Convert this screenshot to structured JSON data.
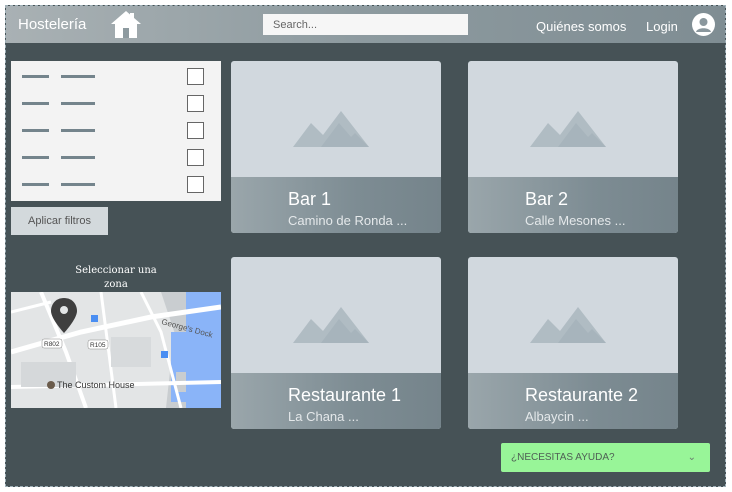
{
  "header": {
    "brand": "Hostelería",
    "search_placeholder": "Search...",
    "nav_about": "Quiénes somos",
    "nav_login": "Login"
  },
  "filters": {
    "row_count": 5,
    "apply_label": "Aplicar filtros"
  },
  "map": {
    "zone_label": "Seleccionar una zona",
    "labels": [
      "George's Dock",
      "R802",
      "R105",
      "The Custom House"
    ]
  },
  "cards": [
    {
      "title": "Bar 1",
      "subtitle": "Camino de Ronda ..."
    },
    {
      "title": "Bar 2",
      "subtitle": "Calle Mesones ..."
    },
    {
      "title": "Restaurante 1",
      "subtitle": "La Chana ..."
    },
    {
      "title": "Restaurante 2",
      "subtitle": "Albaycin ..."
    }
  ],
  "help": {
    "label": "¿NECESITAS AYUDA?"
  },
  "colors": {
    "background": "#465256",
    "card": "#d1d8de",
    "help": "#98f598"
  }
}
